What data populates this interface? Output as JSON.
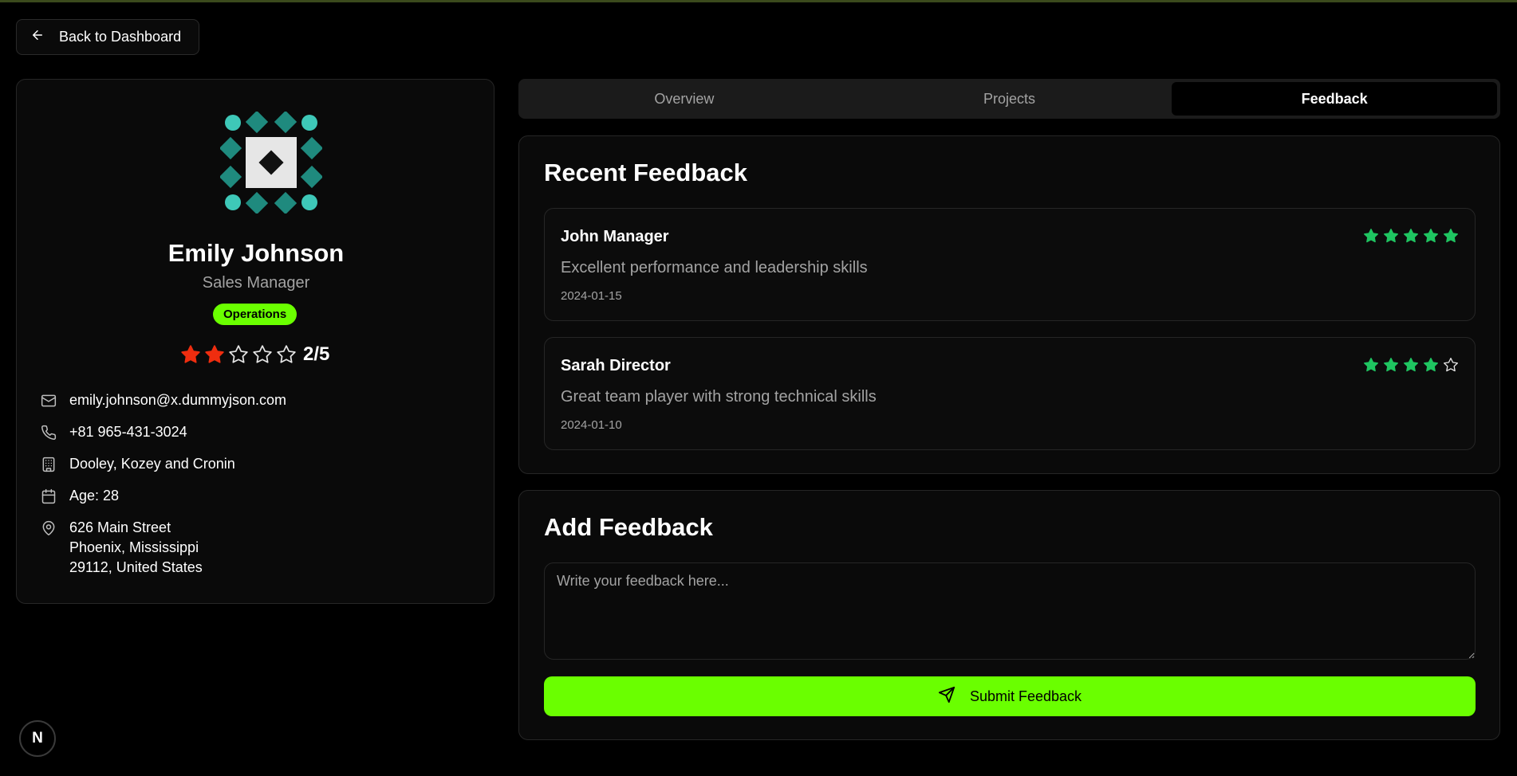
{
  "nav": {
    "back_label": "Back to Dashboard"
  },
  "profile": {
    "name": "Emily Johnson",
    "title": "Sales Manager",
    "department": "Operations",
    "rating": 2,
    "rating_max": 5,
    "rating_text": "2/5",
    "email": "emily.johnson@x.dummyjson.com",
    "phone": "+81 965-431-3024",
    "company": "Dooley, Kozey and Cronin",
    "age": "Age: 28",
    "address": {
      "line1": "626 Main Street",
      "line2": "Phoenix, Mississippi",
      "line3": "29112, United States"
    }
  },
  "tabs": [
    {
      "label": "Overview"
    },
    {
      "label": "Projects"
    },
    {
      "label": "Feedback"
    }
  ],
  "recent_feedback": {
    "title": "Recent Feedback",
    "items": [
      {
        "author": "John Manager",
        "text": "Excellent performance and leadership skills",
        "date": "2024-01-15",
        "rating": 5
      },
      {
        "author": "Sarah Director",
        "text": "Great team player with strong technical skills",
        "date": "2024-01-10",
        "rating": 4
      }
    ]
  },
  "add_feedback": {
    "title": "Add Feedback",
    "placeholder": "Write your feedback here...",
    "submit_label": "Submit Feedback"
  },
  "colors": {
    "accent": "#6aff00",
    "star_red": "#ef2d0f",
    "star_green": "#1fc561",
    "avatar_teal": "#1f8a7e",
    "avatar_light_teal": "#3ec8b8"
  },
  "badge": {
    "letter": "N"
  }
}
